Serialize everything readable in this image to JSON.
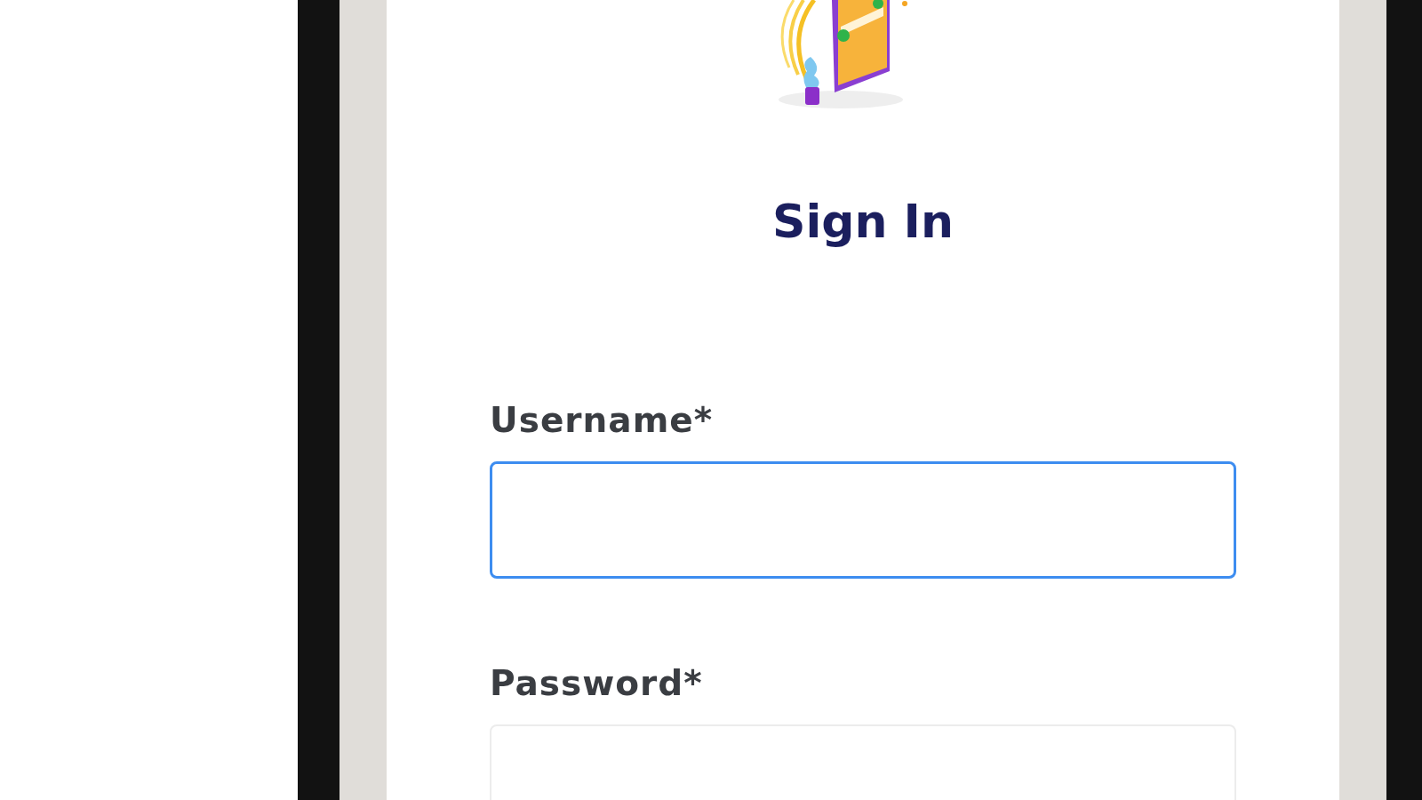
{
  "title": "Sign In",
  "fields": [
    {
      "label": "Username*",
      "focused": true
    },
    {
      "label": "Password*",
      "focused": false
    }
  ]
}
